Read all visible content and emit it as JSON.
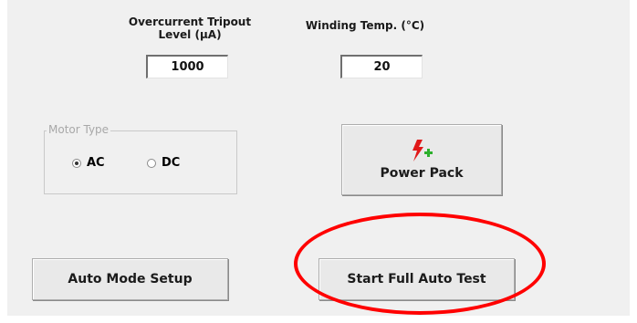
{
  "overcurrent": {
    "label": "Overcurrent Tripout\nLevel (µA)",
    "value": "1000"
  },
  "winding": {
    "label": "Winding Temp. (°C)",
    "value": "20"
  },
  "motor_type": {
    "legend": "Motor Type",
    "options": [
      {
        "label": "AC",
        "selected": true
      },
      {
        "label": "DC",
        "selected": false
      }
    ]
  },
  "power_pack": {
    "label": "Power Pack",
    "icon": "lightning-plus-icon",
    "colors": {
      "bolt": "#e01818",
      "plus": "#2db02d"
    }
  },
  "buttons": {
    "auto_mode_setup": "Auto Mode Setup",
    "start_full_auto_test": "Start Full Auto Test"
  },
  "annotation": {
    "oval_color": "#ff0000"
  }
}
